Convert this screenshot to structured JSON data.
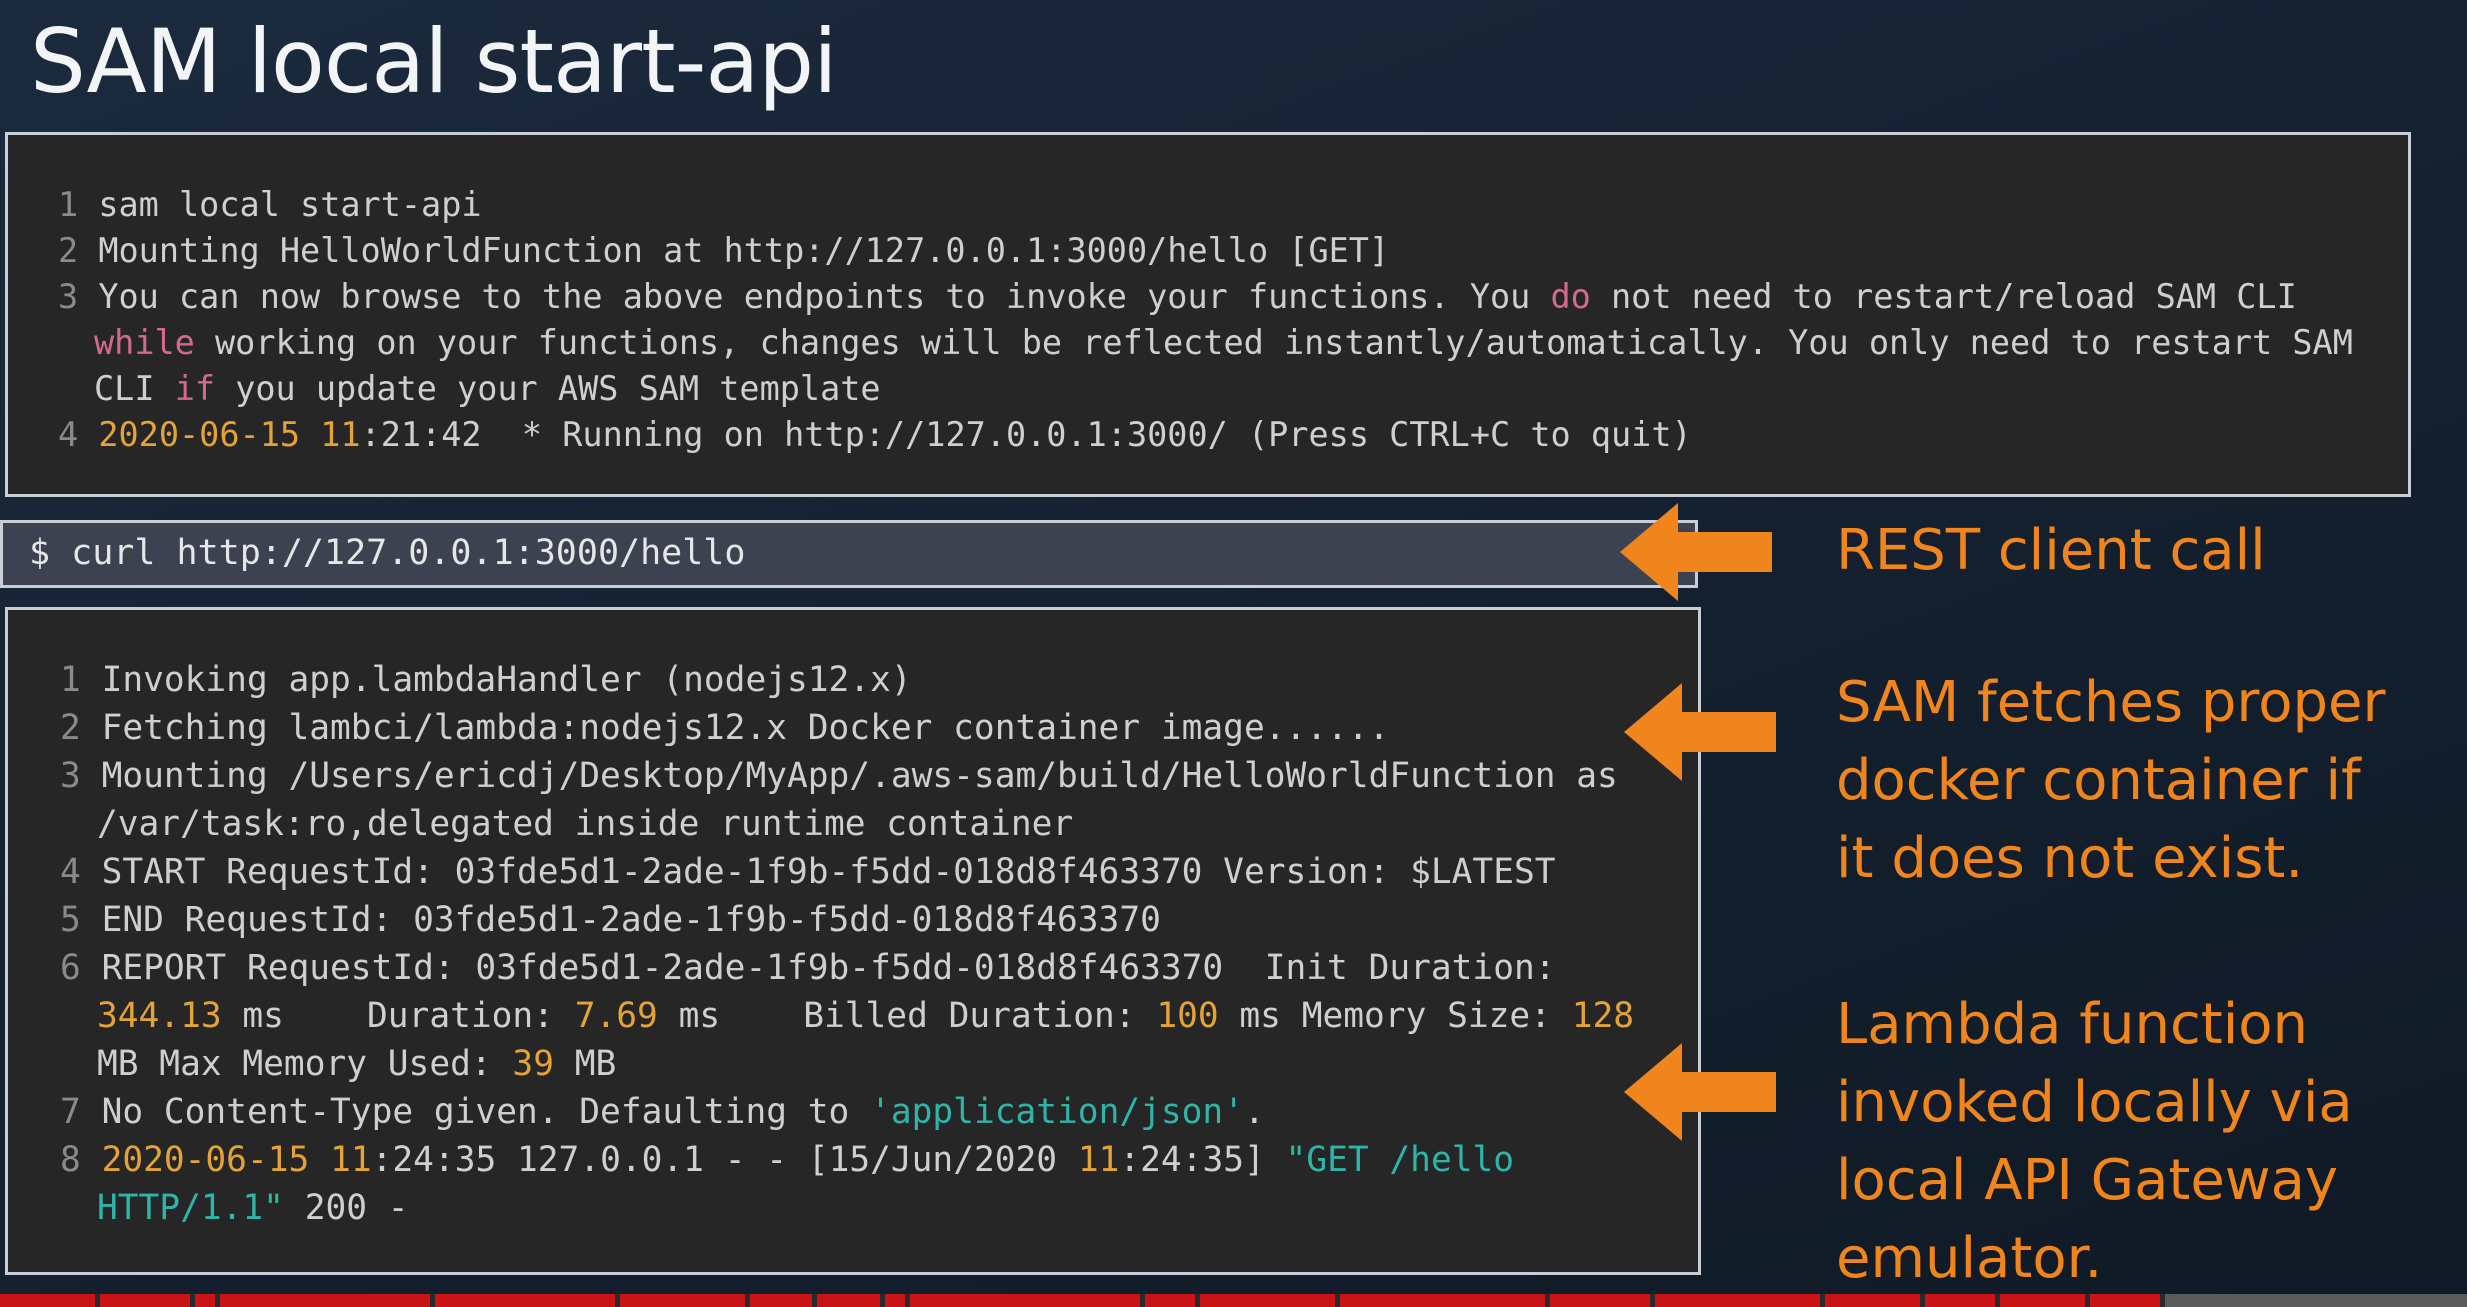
{
  "slide": {
    "title": "SAM local start-api"
  },
  "terminal_server": {
    "lines": [
      {
        "n": "1",
        "text": "sam local start-api"
      },
      {
        "n": "2",
        "text": "Mounting HelloWorldFunction at http://127.0.0.1:3000/hello [GET]"
      },
      {
        "n": "3",
        "a": "You can now browse to the above endpoints to invoke your functions. You ",
        "kw1": "do",
        "b": " not need to restart/reload SAM CLI"
      },
      {
        "kw": "while",
        "text": " working on your functions, changes will be reflected instantly/automatically. You only need to restart SAM"
      },
      {
        "a": "CLI ",
        "kw": "if",
        "b": " you update your AWS SAM template"
      },
      {
        "n": "4",
        "date": "2020-06-15",
        "hour": "11",
        "rest": ":21:42  * Running on http://127.0.0.1:3000/ (Press CTRL+C to quit)"
      }
    ]
  },
  "command": {
    "text": "$ curl http://127.0.0.1:3000/hello"
  },
  "terminal_invoke": {
    "lines": [
      {
        "n": "1",
        "text": "Invoking app.lambdaHandler (nodejs12.x)"
      },
      {
        "n": "2",
        "text": "Fetching lambci/lambda:nodejs12.x Docker container image......"
      },
      {
        "n": "3",
        "text": "Mounting /Users/ericdj/Desktop/MyApp/.aws-sam/build/HelloWorldFunction as"
      },
      {
        "text": "/var/task:ro,delegated inside runtime container"
      },
      {
        "n": "4",
        "text": "START RequestId: 03fde5d1-2ade-1f9b-f5dd-018d8f463370 Version: $LATEST"
      },
      {
        "n": "5",
        "text": "END RequestId: 03fde5d1-2ade-1f9b-f5dd-018d8f463370"
      },
      {
        "n": "6",
        "text": "REPORT RequestId: 03fde5d1-2ade-1f9b-f5dd-018d8f463370  Init Duration:"
      },
      {
        "init_val": "344.13",
        "init_unit": " ms    Duration: ",
        "dur_val": "7.69",
        "dur_unit": " ms    Billed Duration: ",
        "billed_val": "100",
        "billed_unit": " ms Memory Size: ",
        "mem_val": "128"
      },
      {
        "a": "MB Max Memory Used: ",
        "used_val": "39",
        "b": " MB"
      },
      {
        "n": "7",
        "a": "No Content-Type given. Defaulting to ",
        "str": "'application/json'",
        "b": "."
      },
      {
        "n": "8",
        "date": "2020-06-15",
        "hour": "11",
        "rest1": ":24:35 127.0.0.1 - - [15/Jun/2020 ",
        "hour2": "11",
        "rest2": ":24:35] ",
        "str": "\"GET /hello"
      },
      {
        "str": "HTTP/1.1\"",
        "code": " 200 -"
      }
    ]
  },
  "annotations": {
    "rest_call": "REST client call",
    "fetch": "SAM fetches proper\ndocker container if\nit does not exist.",
    "invoke": "Lambda function\ninvoked locally via\nlocal API Gateway\nemulator."
  },
  "colors": {
    "accent": "#f0851d",
    "keyword": "#d46a8a",
    "number": "#e3a23a",
    "string": "#2fb5a8"
  }
}
